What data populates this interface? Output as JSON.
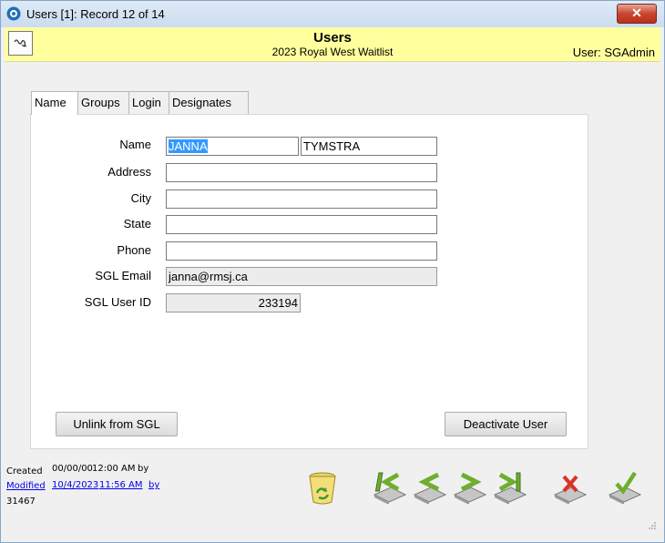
{
  "window": {
    "title": "Users [1]: Record 12 of 14",
    "close_label": "✕"
  },
  "header": {
    "title": "Users",
    "subtitle": "2023 Royal West Waitlist",
    "user": "User: SGAdmin"
  },
  "tabs": [
    {
      "label": "Name",
      "active": true
    },
    {
      "label": "Groups",
      "active": false
    },
    {
      "label": "Login",
      "active": false
    },
    {
      "label": "Designates",
      "active": false
    }
  ],
  "form": {
    "name_label": "Name",
    "first_name": "JANNA",
    "last_name": "TYMSTRA",
    "address_label": "Address",
    "address": "",
    "city_label": "City",
    "city": "",
    "state_label": "State",
    "state": "",
    "phone_label": "Phone",
    "phone": "",
    "sgl_email_label": "SGL Email",
    "sgl_email": "janna@rmsj.ca",
    "sgl_user_id_label": "SGL User ID",
    "sgl_user_id": "233194"
  },
  "buttons": {
    "unlink": "Unlink from SGL",
    "deactivate": "Deactivate User"
  },
  "footer": {
    "created_label": "Created",
    "created_date": "00/00/00",
    "created_time": "12:00 AM",
    "created_by": "by",
    "modified_label": "Modified",
    "modified_date": "10/4/2023",
    "modified_time": "11:56 AM",
    "modified_by": "by",
    "record_id": "31467"
  },
  "icons": [
    "recycle-bin-icon",
    "first-record-icon",
    "previous-record-icon",
    "next-record-icon",
    "last-record-icon",
    "delete-record-icon",
    "save-record-icon"
  ],
  "colors": {
    "header_bg": "#ffff9d",
    "nav_green": "#6fae2e",
    "delete_red": "#d8342a"
  }
}
